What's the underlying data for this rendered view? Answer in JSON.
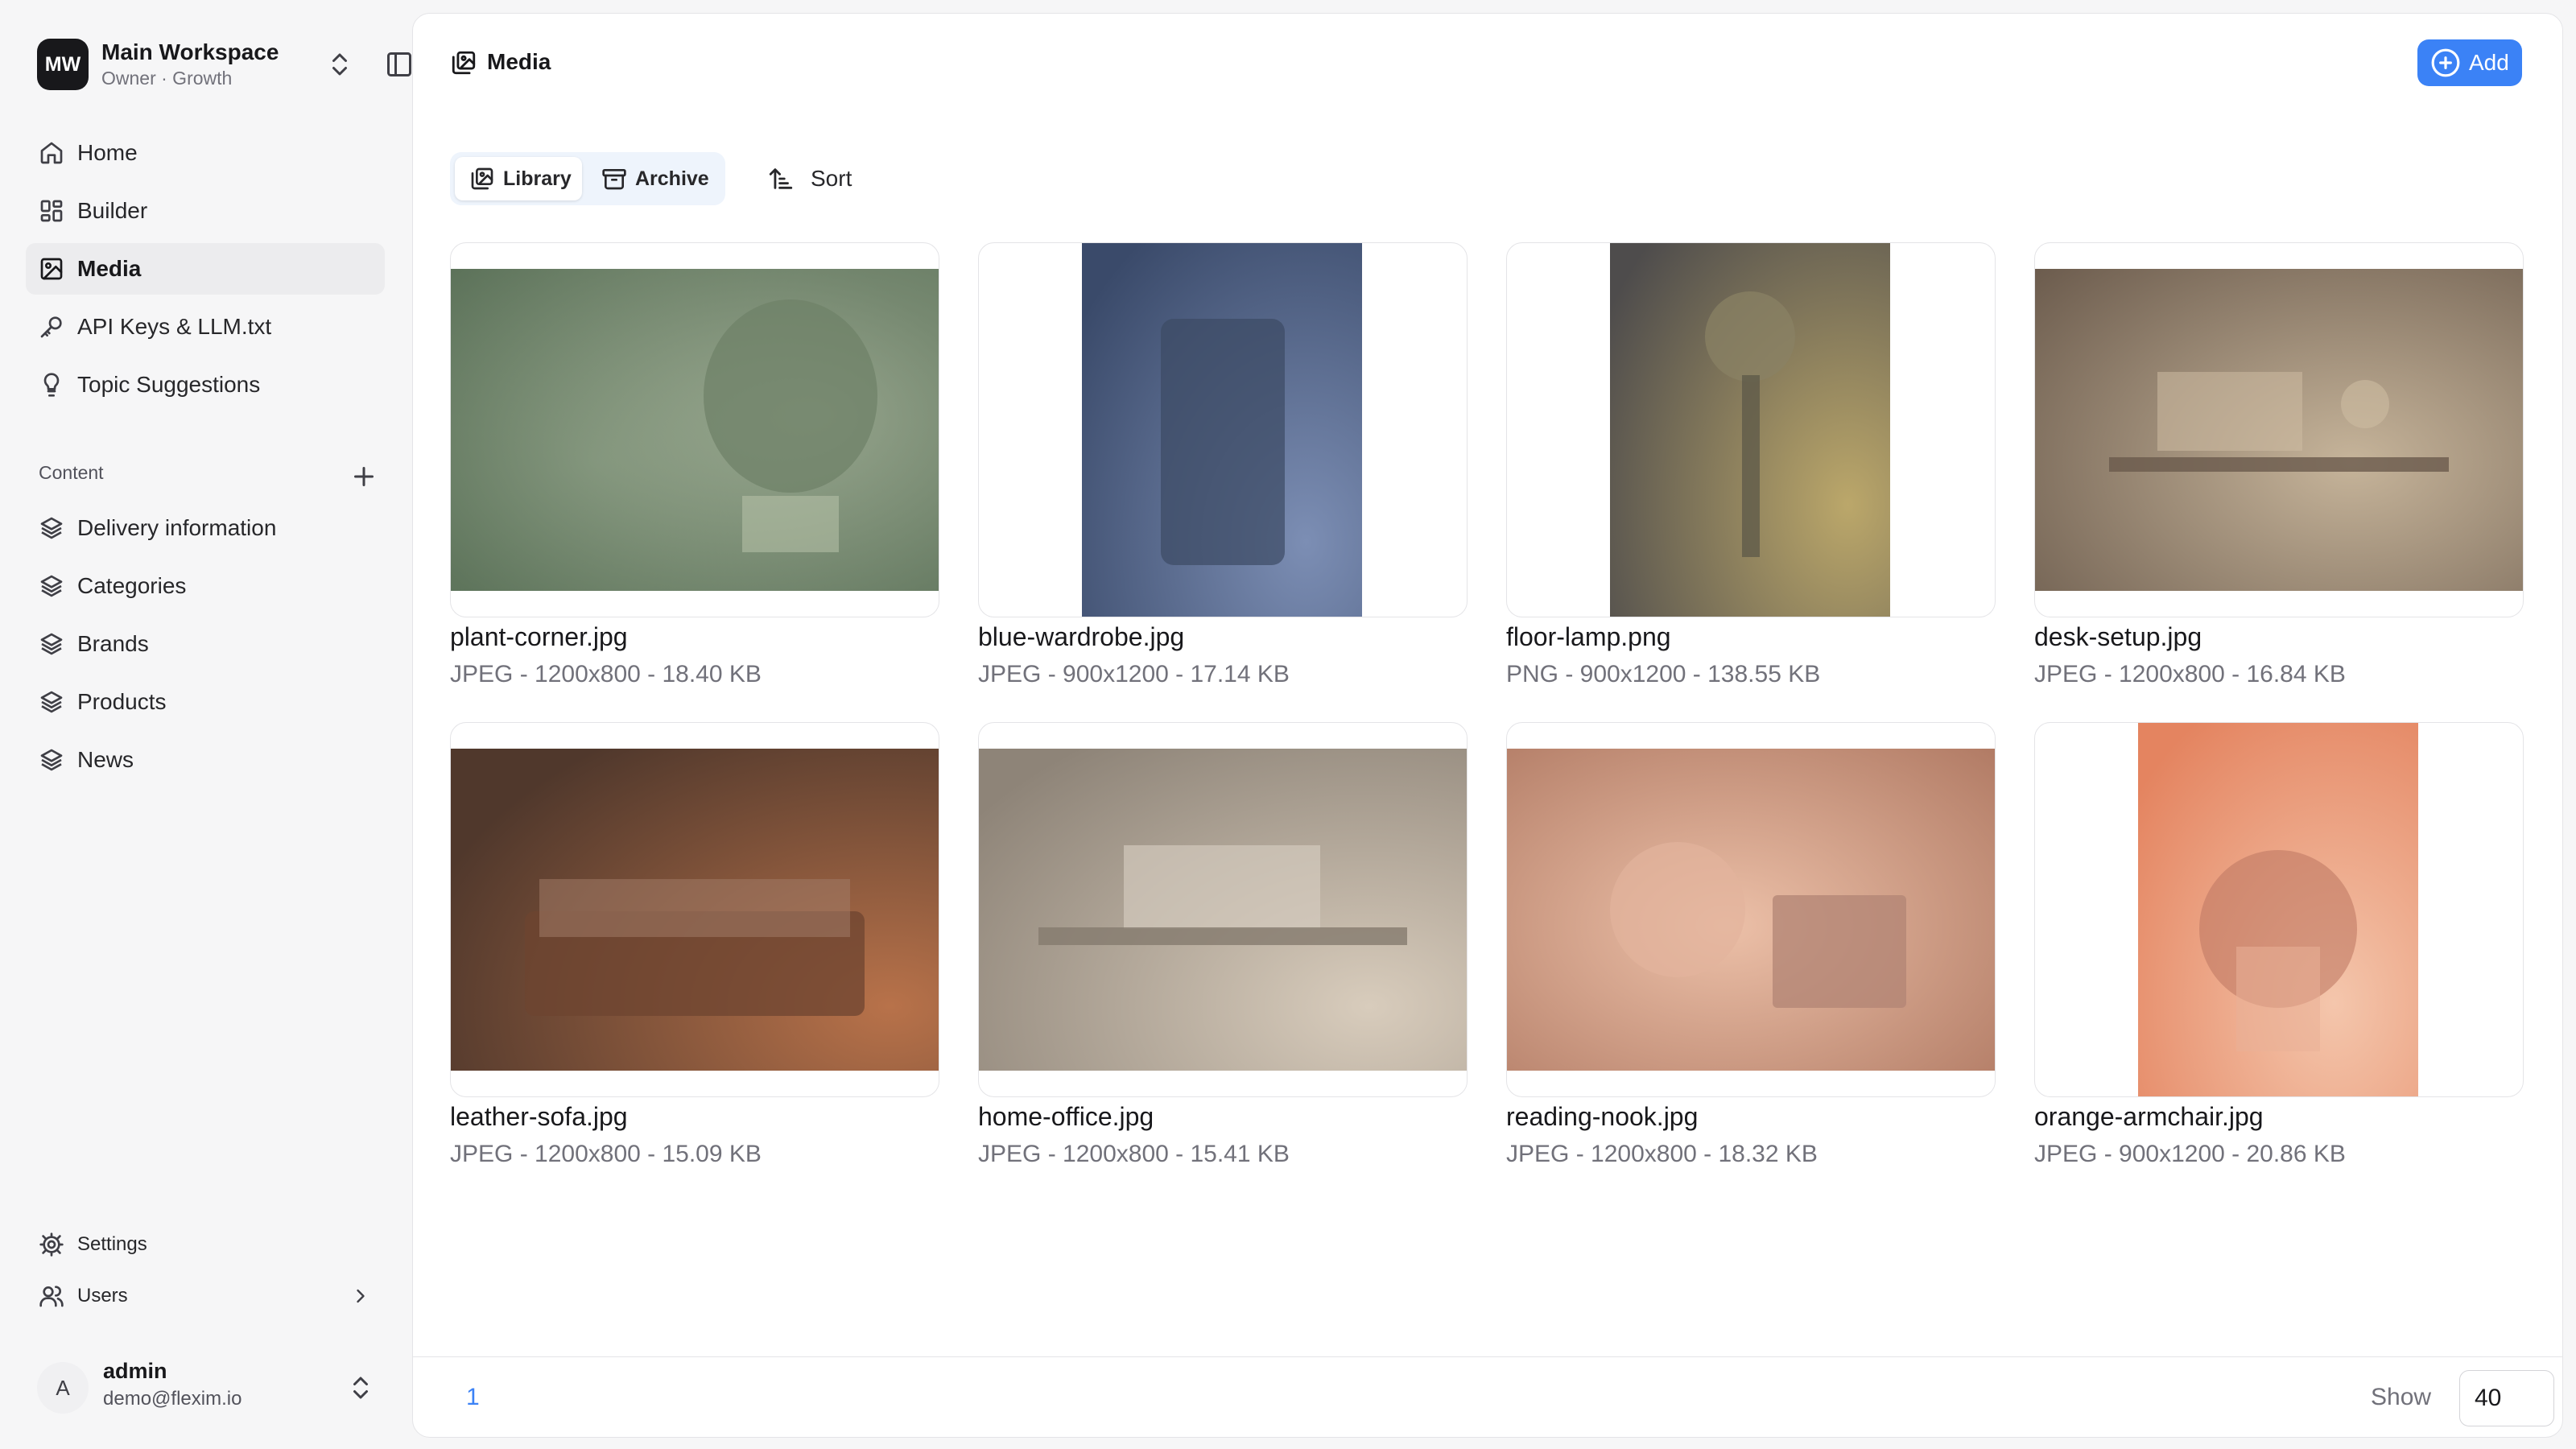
{
  "workspace": {
    "initials": "MW",
    "name": "Main Workspace",
    "subtitle": "Owner · Growth"
  },
  "nav": [
    {
      "label": "Home",
      "icon": "home-icon",
      "active": false
    },
    {
      "label": "Builder",
      "icon": "grid-icon",
      "active": false
    },
    {
      "label": "Media",
      "icon": "image-icon",
      "active": true
    },
    {
      "label": "API Keys & LLM.txt",
      "icon": "key-icon",
      "active": false
    },
    {
      "label": "Topic Suggestions",
      "icon": "lightbulb-icon",
      "active": false
    }
  ],
  "content_section": {
    "label": "Content",
    "items": [
      {
        "label": "Delivery information",
        "icon": "layers-icon"
      },
      {
        "label": "Categories",
        "icon": "layers-icon"
      },
      {
        "label": "Brands",
        "icon": "layers-icon"
      },
      {
        "label": "Products",
        "icon": "layers-icon"
      },
      {
        "label": "News",
        "icon": "layers-icon"
      }
    ]
  },
  "bottom_nav": {
    "settings": {
      "label": "Settings",
      "icon": "gear-icon"
    },
    "users": {
      "label": "Users",
      "icon": "users-icon"
    }
  },
  "user": {
    "initial": "A",
    "name": "admin",
    "email": "demo@flexim.io"
  },
  "header": {
    "title": "Media",
    "add_label": "Add"
  },
  "toolbar": {
    "library_label": "Library",
    "archive_label": "Archive",
    "sort_label": "Sort"
  },
  "media": [
    {
      "name": "plant-corner.jpg",
      "meta": "JPEG - 1200x800 - 18.40 KB"
    },
    {
      "name": "blue-wardrobe.jpg",
      "meta": "JPEG - 900x1200 - 17.14 KB"
    },
    {
      "name": "floor-lamp.png",
      "meta": "PNG - 900x1200 - 138.55 KB"
    },
    {
      "name": "desk-setup.jpg",
      "meta": "JPEG - 1200x800 - 16.84 KB"
    },
    {
      "name": "leather-sofa.jpg",
      "meta": "JPEG - 1200x800 - 15.09 KB"
    },
    {
      "name": "home-office.jpg",
      "meta": "JPEG - 1200x800 - 15.41 KB"
    },
    {
      "name": "reading-nook.jpg",
      "meta": "JPEG - 1200x800 - 18.32 KB"
    },
    {
      "name": "orange-armchair.jpg",
      "meta": "JPEG - 900x1200 - 20.86 KB"
    }
  ],
  "pagination": {
    "current_page": "1",
    "show_label": "Show",
    "page_size": "40"
  },
  "colors": {
    "accent": "#3b82f6",
    "sidebar_bg": "#f6f6f7",
    "active_item_bg": "#ececee"
  }
}
